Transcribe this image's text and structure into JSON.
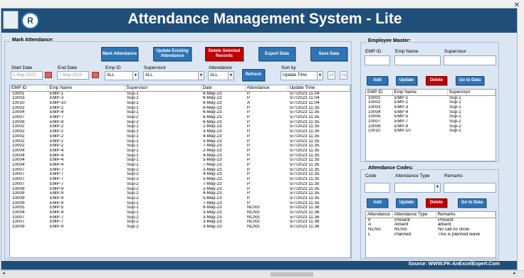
{
  "window": {
    "title": "Attendance Management System - Lite",
    "close_icon": "✕"
  },
  "logo_text": "R",
  "mark": {
    "legend": "Mark Attendance:",
    "buttons": {
      "mark": "Mark Attendance",
      "update": "Update Existing Attendance",
      "delete": "Delete Selected Records",
      "export": "Export Data",
      "save": "Save Data",
      "refresh": "Refresh"
    },
    "filters": {
      "start_label": "Start Date",
      "start_value": "1-May-2023",
      "end_label": "End Date",
      "end_value": "7-May-2023",
      "emp_label": "Emp ID",
      "emp_value": "ALL",
      "sup_label": "Supervisor",
      "sup_value": "ALL",
      "att_label": "Attendance",
      "att_value": "ALL",
      "sort_label": "Sort by",
      "sort_value": "Update Time",
      "sort_asc": "↓↑",
      "sort_desc": "↑↓"
    },
    "columns": [
      "EMP ID",
      "Emp Name",
      "Supervisor",
      "Date",
      "Attendance",
      "Update Time"
    ],
    "rows": [
      [
        "10001",
        "EMP-1",
        "Sup-1",
        "6-May-23",
        "P",
        "5/7/2023 11:04"
      ],
      [
        "10003",
        "EMP-3",
        "Sup-1",
        "6-May-23",
        "P",
        "5/7/2023 11:04"
      ],
      [
        "10010",
        "EMP-10",
        "Sup-2",
        "6-May-23",
        "A",
        "5/7/2023 11:04"
      ],
      [
        "10002",
        "EMP-2",
        "Sup-1",
        "6-May-23",
        "P",
        "5/7/2023 11:35"
      ],
      [
        "10004",
        "EMP-4",
        "Sup-1",
        "6-May-23",
        "P",
        "5/7/2023 11:35"
      ],
      [
        "10007",
        "EMP-7",
        "Sup-2",
        "6-May-23",
        "P",
        "5/7/2023 11:35"
      ],
      [
        "10009",
        "EMP-9",
        "Sup-2",
        "6-May-23",
        "P",
        "5/7/2023 11:35"
      ],
      [
        "10002",
        "EMP-2",
        "Sup-1",
        "2-May-23",
        "P",
        "5/7/2023 11:35"
      ],
      [
        "10002",
        "EMP-2",
        "Sup-1",
        "3-May-23",
        "P",
        "5/7/2023 11:35"
      ],
      [
        "10002",
        "EMP-2",
        "Sup-1",
        "4-May-23",
        "P",
        "5/7/2023 11:35"
      ],
      [
        "10002",
        "EMP-2",
        "Sup-1",
        "5-May-23",
        "P",
        "5/7/2023 11:35"
      ],
      [
        "10002",
        "EMP-2",
        "Sup-1",
        "7-May-23",
        "P",
        "5/7/2023 11:35"
      ],
      [
        "10004",
        "EMP-4",
        "Sup-1",
        "2-May-23",
        "P",
        "5/7/2023 11:35"
      ],
      [
        "10004",
        "EMP-4",
        "Sup-1",
        "4-May-23",
        "P",
        "5/7/2023 11:35"
      ],
      [
        "10004",
        "EMP-4",
        "Sup-1",
        "5-May-23",
        "P",
        "5/7/2023 11:35"
      ],
      [
        "10004",
        "EMP-4",
        "Sup-1",
        "7-May-23",
        "P",
        "5/7/2023 11:35"
      ],
      [
        "10007",
        "EMP-7",
        "Sup-2",
        "2-May-23",
        "P",
        "5/7/2023 11:35"
      ],
      [
        "10007",
        "EMP-7",
        "Sup-2",
        "4-May-23",
        "P",
        "5/7/2023 11:35"
      ],
      [
        "10007",
        "EMP-7",
        "Sup-2",
        "5-May-23",
        "P",
        "5/7/2023 11:35"
      ],
      [
        "10007",
        "EMP-7",
        "Sup-2",
        "7-May-23",
        "P",
        "5/7/2023 11:35"
      ],
      [
        "10009",
        "EMP-9",
        "Sup-2",
        "2-May-23",
        "P",
        "5/7/2023 11:35"
      ],
      [
        "10009",
        "EMP-9",
        "Sup-2",
        "4-May-23",
        "P",
        "5/7/2023 11:35"
      ],
      [
        "10009",
        "EMP-9",
        "Sup-2",
        "5-May-23",
        "P",
        "5/7/2023 11:35"
      ],
      [
        "10009",
        "EMP-9",
        "Sup-2",
        "7-May-23",
        "P",
        "5/7/2023 11:35"
      ],
      [
        "10005",
        "EMP-5",
        "Sup-1",
        "6-May-23",
        "NCNS",
        "5/7/2023 11:36"
      ],
      [
        "10004",
        "EMP-4",
        "Sup-1",
        "3-May-23",
        "NCNS",
        "5/7/2023 11:36"
      ],
      [
        "10007",
        "EMP-7",
        "Sup-2",
        "3-May-23",
        "NCNS",
        "5/7/2023 11:36"
      ],
      [
        "10007",
        "EMP-7",
        "Sup-2",
        "3-May-23",
        "NCNS",
        "5/7/2023 11:36"
      ],
      [
        "10009",
        "EMP-9",
        "Sup-2",
        "3-May-23",
        "NCNS",
        "5/7/2023 11:36"
      ]
    ]
  },
  "employee": {
    "legend": "Employee Master:",
    "emp_id_label": "EMP ID",
    "emp_name_label": "Emp Name",
    "sup_label": "Supervisor",
    "buttons": {
      "add": "Add",
      "update": "Update",
      "delete": "Delete",
      "goto": "Go to Data"
    },
    "columns": [
      "EMP ID",
      "Emp Name",
      "Supervisor"
    ],
    "rows": [
      [
        "10001",
        "EMP-1",
        "Sup-1"
      ],
      [
        "10002",
        "EMP-2",
        "Sup-1"
      ],
      [
        "10003",
        "EMP-3",
        "Sup-1"
      ],
      [
        "10004",
        "EMP-4",
        "Sup-1"
      ],
      [
        "10005",
        "EMP-5",
        "Sup-1"
      ],
      [
        "10007",
        "EMP-7",
        "Sup-2"
      ],
      [
        "10009",
        "EMP-9",
        "Sup-2"
      ],
      [
        "10010",
        "EMP-10",
        "Sup-2"
      ]
    ]
  },
  "codes": {
    "legend": "Attendance Codes:",
    "code_label": "Code",
    "type_label": "Attendance Type",
    "remarks_label": "Remarks",
    "buttons": {
      "add": "Add",
      "update": "Update",
      "delete": "Delete",
      "goto": "Go to Data"
    },
    "columns": [
      "Attendance",
      "Attendance Type",
      "Remarks"
    ],
    "rows": [
      [
        "P",
        "Present",
        "Present"
      ],
      [
        "A",
        "Absent",
        "absent"
      ],
      [
        "NCNS",
        "NCNS",
        "No call no show"
      ],
      [
        "L",
        "Planned",
        "This is planned leave"
      ]
    ]
  },
  "footer": "Source: WWW.PK-AnExcelExpert.Com",
  "scroll": {
    "left": "◄",
    "right": "►"
  }
}
